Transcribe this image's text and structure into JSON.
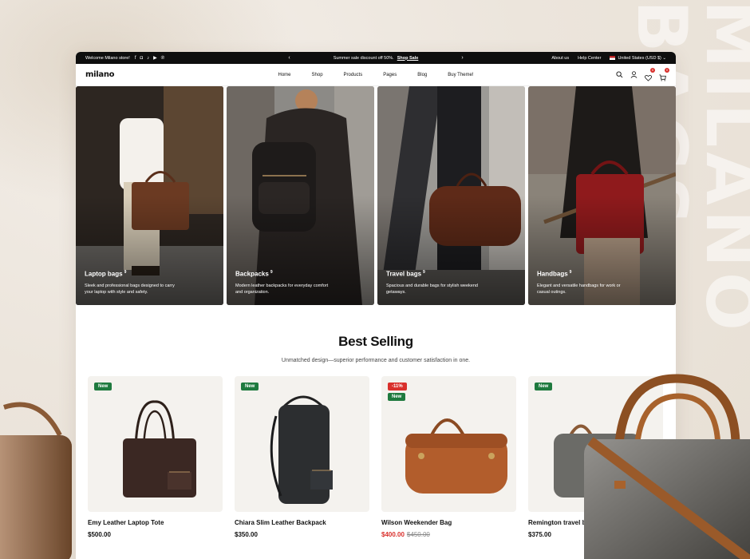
{
  "watermark": "MILANO BAGS",
  "topbar": {
    "welcome": "Welcome Milano store!",
    "social_icons": [
      "facebook-icon",
      "instagram-icon",
      "tiktok-icon",
      "youtube-icon",
      "pinterest-icon"
    ],
    "promo_text": "Summer sale discount off 50%.",
    "promo_link": "Shop Sale",
    "links": [
      "About us",
      "Help Center"
    ],
    "locale": "United States (USD $)"
  },
  "navbar": {
    "logo": "milano",
    "menu": [
      "Home",
      "Shop",
      "Products",
      "Pages",
      "Blog",
      "Buy Theme!"
    ],
    "wishlist_count": "0",
    "cart_count": "0"
  },
  "categories": [
    {
      "title": "Laptop bags",
      "count": "9",
      "desc": "Sleek and professional bags designed to carry your laptop with style and safety."
    },
    {
      "title": "Backpacks",
      "count": "9",
      "desc": "Modern leather backpacks for everyday comfort and organization."
    },
    {
      "title": "Travel bags",
      "count": "9",
      "desc": "Spacious and durable bags for stylish weekend getaways."
    },
    {
      "title": "Handbags",
      "count": "9",
      "desc": "Elegant and versatile handbags for work or casual outings."
    }
  ],
  "best_selling": {
    "title": "Best Selling",
    "subtitle": "Unmatched design—superior performance and customer satisfaction in one."
  },
  "products": [
    {
      "name": "Emy Leather Laptop Tote",
      "price": "$500.00",
      "tags": [
        "New"
      ]
    },
    {
      "name": "Chiara Slim Leather Backpack",
      "price": "$350.00",
      "tags": [
        "New"
      ]
    },
    {
      "name": "Wilson Weekender Bag",
      "price": "$400.00",
      "old_price": "$450.00",
      "tags": [
        "-11%",
        "New"
      ]
    },
    {
      "name": "Remington travel bag",
      "price": "$375.00",
      "tags": [
        "New"
      ]
    }
  ],
  "colors": {
    "accent_sale": "#d9302c",
    "tag_new": "#1f7a3f",
    "topbar": "#0e0e0e"
  }
}
